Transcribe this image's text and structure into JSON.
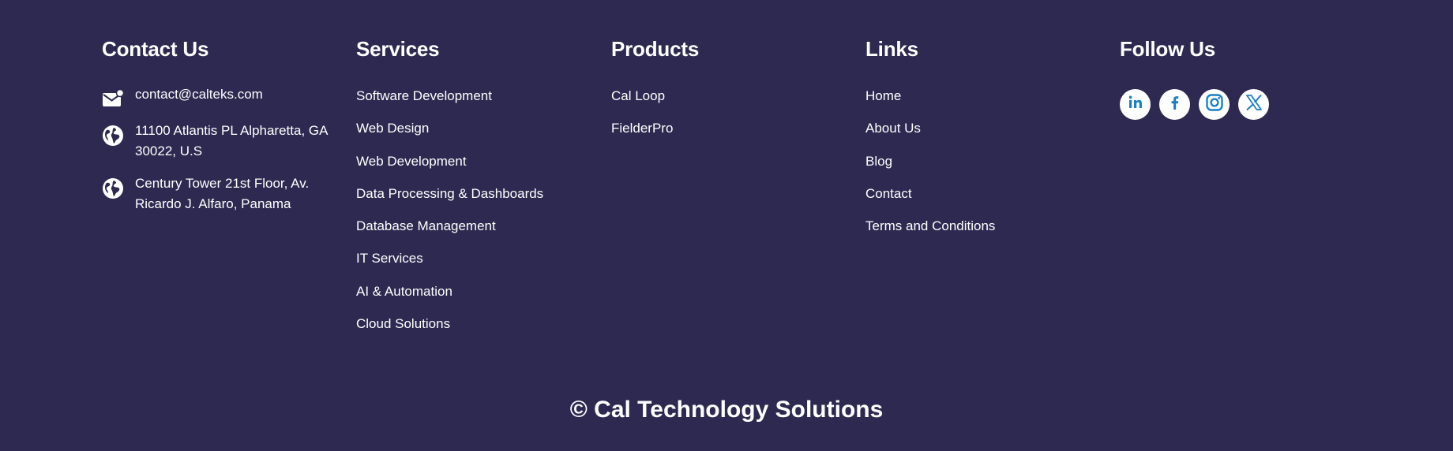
{
  "contact": {
    "heading": "Contact Us",
    "email": "contact@calteks.com",
    "addresses": [
      "11100 Atlantis PL Alpharetta, GA 30022, U.S",
      "Century Tower 21st Floor, Av. Ricardo J. Alfaro, Panama"
    ],
    "icons": [
      "mail-icon",
      "globe-icon",
      "globe-icon"
    ]
  },
  "services": {
    "heading": "Services",
    "items": [
      "Software Development",
      "Web Design",
      "Web Development",
      "Data Processing & Dashboards",
      "Database Management",
      "IT Services",
      "AI & Automation",
      "Cloud Solutions"
    ]
  },
  "products": {
    "heading": "Products",
    "items": [
      "Cal Loop",
      "FielderPro"
    ]
  },
  "links": {
    "heading": "Links",
    "items": [
      "Home",
      "About Us",
      "Blog",
      "Contact",
      "Terms and Conditions"
    ]
  },
  "follow": {
    "heading": "Follow Us",
    "icons": [
      "linkedin-icon",
      "facebook-icon",
      "instagram-icon",
      "x-icon"
    ]
  },
  "copyright": "© Cal Technology Solutions",
  "colors": {
    "background": "#2e2950",
    "text": "#ffffff",
    "social_icon": "#1b7fc4"
  }
}
